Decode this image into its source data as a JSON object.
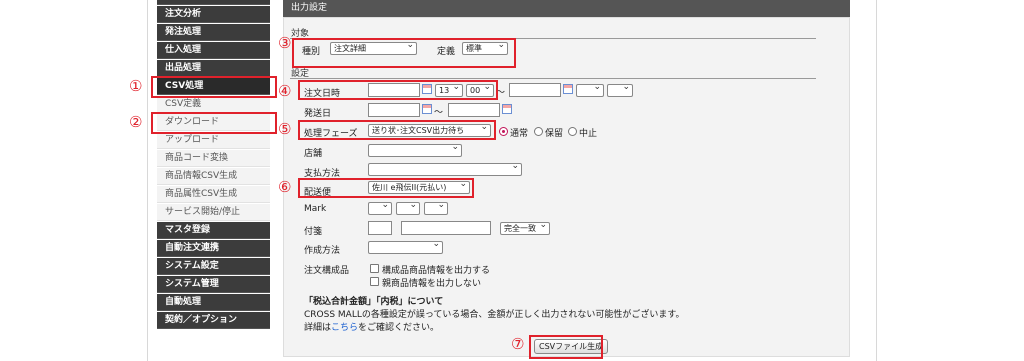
{
  "sidebar": {
    "items": [
      {
        "label": "注文分析"
      },
      {
        "label": "発注処理"
      },
      {
        "label": "仕入処理"
      },
      {
        "label": "出品処理"
      },
      {
        "label": "CSV処理"
      },
      {
        "label": "CSV定義"
      },
      {
        "label": "ダウンロード"
      },
      {
        "label": "アップロード"
      },
      {
        "label": "商品コード変換"
      },
      {
        "label": "商品情報CSV生成"
      },
      {
        "label": "商品属性CSV生成"
      },
      {
        "label": "サービス開始/停止"
      },
      {
        "label": "マスタ登録"
      },
      {
        "label": "自動注文連携"
      },
      {
        "label": "システム設定"
      },
      {
        "label": "システム管理"
      },
      {
        "label": "自動処理"
      },
      {
        "label": "契約／オプション"
      }
    ]
  },
  "markers": {
    "m1": "①",
    "m2": "②",
    "m3": "③",
    "m4": "④",
    "m5": "⑤",
    "m6": "⑥",
    "m7": "⑦"
  },
  "panel": {
    "header": "出力設定",
    "target_title": "対象",
    "settings_title": "設定",
    "type_label": "種別",
    "type_value": "注文詳細",
    "def_label": "定義",
    "def_value": "標準",
    "order_date_label": "注文日時",
    "hour_value": "13",
    "minute_value": "00",
    "tilde": "〜",
    "ship_date_label": "発送日",
    "phase_label": "処理フェーズ",
    "phase_value": "送り状･注文CSV出力待ち",
    "radio_normal": "通常",
    "radio_hold": "保留",
    "radio_cancel": "中止",
    "store_label": "店舗",
    "payment_label": "支払方法",
    "delivery_label": "配送便",
    "delivery_value": "佐川 e飛伝II(元払い)",
    "mark_label": "Mark",
    "memo_label": "付箋",
    "match_value": "完全一致",
    "create_label": "作成方法",
    "components_label": "注文構成品",
    "chk_components": "構成品商品情報を出力する",
    "chk_parent": "親商品情報を出力しない",
    "notice_title": "「税込合計金額」「内税」について",
    "notice_line1": "CROSS MALLの各種設定が誤っている場合、金額が正しく出力されない可能性がございます。",
    "notice_line2_a": "詳細は",
    "notice_link": "こちら",
    "notice_line2_b": "をご確認ください。",
    "generate_button": "CSVファイル生成"
  }
}
